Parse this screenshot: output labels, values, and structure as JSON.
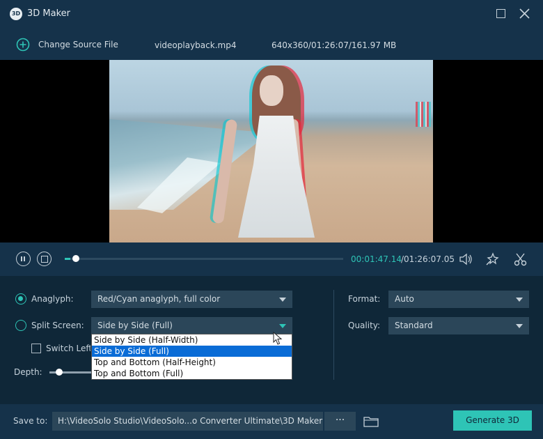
{
  "window": {
    "title": "3D Maker",
    "logo_text": "3D"
  },
  "source": {
    "change_label": "Change Source File",
    "file_name": "videoplayback.mp4",
    "file_info": "640x360/01:26:07/161.97 MB"
  },
  "player": {
    "current_time": "00:01:47.14",
    "total_time": "/01:26:07.05",
    "progress_fraction": 0.021
  },
  "settings": {
    "anaglyph_label": "Anaglyph:",
    "anaglyph_value": "Red/Cyan anaglyph, full color",
    "split_label": "Split Screen:",
    "split_value": "Side by Side (Full)",
    "switch_label": "Switch Left",
    "depth_label": "Depth:",
    "format_label": "Format:",
    "format_value": "Auto",
    "quality_label": "Quality:",
    "quality_value": "Standard",
    "split_options": [
      "Side by Side (Half-Width)",
      "Side by Side (Full)",
      "Top and Bottom (Half-Height)",
      "Top and Bottom (Full)"
    ],
    "split_selected_index": 1
  },
  "footer": {
    "save_label": "Save to:",
    "save_path": "H:\\VideoSolo Studio\\VideoSolo...o Converter Ultimate\\3D Maker",
    "browse_label": "···",
    "generate_label": "Generate 3D"
  },
  "colors": {
    "accent": "#2ec4b6",
    "panel": "#15324a",
    "background": "#0f2738",
    "field": "#2b4659"
  },
  "icons": {
    "add": "plus-circle-icon",
    "pause": "pause-icon",
    "stop": "stop-icon",
    "volume": "volume-icon",
    "effects": "magic-wand-icon",
    "cut": "scissors-icon",
    "folder": "folder-icon"
  }
}
